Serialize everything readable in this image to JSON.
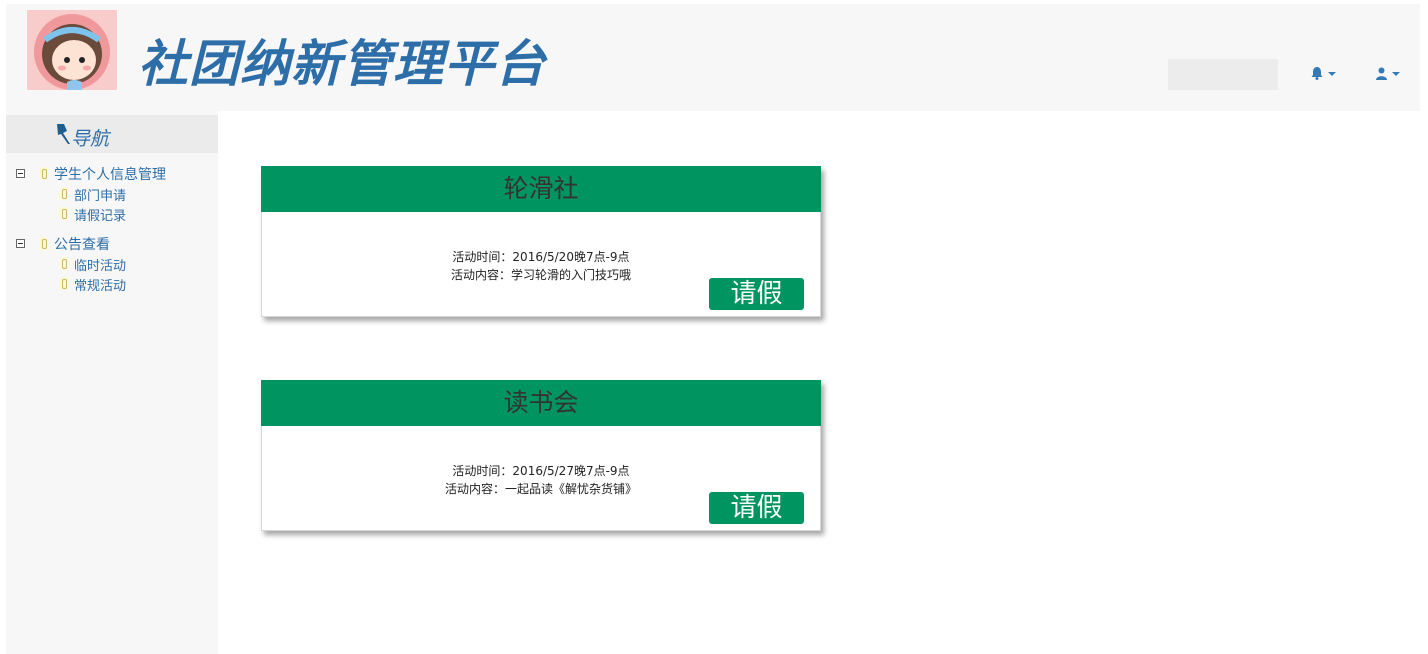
{
  "header": {
    "app_title": "社团纳新管理平台",
    "search_value": "",
    "notification_icon": "bell-icon",
    "user_icon": "user-icon"
  },
  "sidebar": {
    "nav_title": "导航",
    "groups": [
      {
        "label": "学生个人信息管理",
        "items": [
          {
            "label": "部门申请"
          },
          {
            "label": "请假记录"
          }
        ]
      },
      {
        "label": "公告查看",
        "items": [
          {
            "label": "临时活动"
          },
          {
            "label": "常规活动"
          }
        ]
      }
    ]
  },
  "activities": [
    {
      "club": "轮滑社",
      "time": "活动时间：2016/5/20晚7点-9点",
      "content": "活动内容：学习轮滑的入门技巧哦",
      "button": "请假"
    },
    {
      "club": "读书会",
      "time": "活动时间：2016/5/27晚7点-9点",
      "content": "活动内容：一起品读《解忧杂货铺》",
      "button": "请假"
    }
  ],
  "colors": {
    "brand_blue": "#2e6ea8",
    "card_green": "#009460",
    "header_bg": "#f7f7f7"
  }
}
